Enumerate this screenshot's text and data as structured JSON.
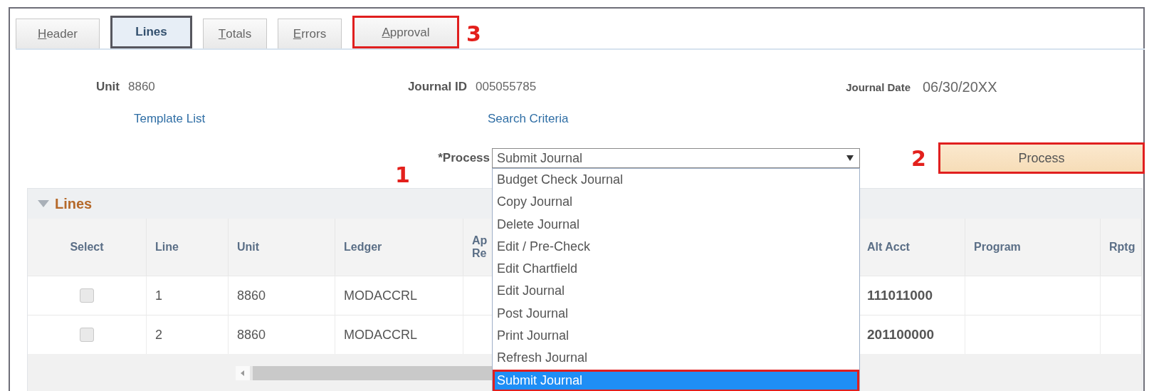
{
  "tabs": [
    {
      "label": "Header",
      "mnemonic": true,
      "selected": false,
      "highlighted": false
    },
    {
      "label": "Lines",
      "mnemonic": false,
      "selected": true,
      "highlighted": false
    },
    {
      "label": "Totals",
      "mnemonic": true,
      "selected": false,
      "highlighted": false
    },
    {
      "label": "Errors",
      "mnemonic": true,
      "selected": false,
      "highlighted": false
    },
    {
      "label": "Approval",
      "mnemonic": true,
      "selected": false,
      "highlighted": true,
      "callout": "3"
    }
  ],
  "header": {
    "unit": {
      "label": "Unit",
      "value": "8860"
    },
    "journal_id": {
      "label": "Journal ID",
      "value": "005055785"
    },
    "journal_date": {
      "label": "Journal Date",
      "value": "06/30/20XX"
    },
    "links": [
      "Template List",
      "Search Criteria"
    ],
    "process_field": {
      "label": "*Process",
      "value": "Submit Journal",
      "callout": "1",
      "expanded": true,
      "options": [
        {
          "label": "Budget Check Journal",
          "selected": false,
          "highlighted": false
        },
        {
          "label": "Copy Journal",
          "selected": false,
          "highlighted": false
        },
        {
          "label": "Delete Journal",
          "selected": false,
          "highlighted": false
        },
        {
          "label": "Edit / Pre-Check",
          "selected": false,
          "highlighted": false
        },
        {
          "label": "Edit Chartfield",
          "selected": false,
          "highlighted": false
        },
        {
          "label": "Edit Journal",
          "selected": false,
          "highlighted": false
        },
        {
          "label": "Post Journal",
          "selected": false,
          "highlighted": false
        },
        {
          "label": "Print Journal",
          "selected": false,
          "highlighted": false
        },
        {
          "label": "Refresh Journal",
          "selected": false,
          "highlighted": false
        },
        {
          "label": "Submit Journal",
          "selected": true,
          "highlighted": true
        }
      ]
    },
    "process_button": {
      "label": "Process",
      "highlighted": true,
      "callout": "2"
    }
  },
  "lines": {
    "title": "Lines",
    "expanded": true,
    "columns": [
      "Select",
      "Line",
      "Unit",
      "Ledger",
      "Ap Re",
      "Alt Acct",
      "Program",
      "Rptg"
    ],
    "rows": [
      {
        "selected": false,
        "cells": [
          "",
          "1",
          "8860",
          "MODACCRL",
          "",
          "111011000",
          "",
          ""
        ]
      },
      {
        "selected": false,
        "cells": [
          "",
          "2",
          "8860",
          "MODACCRL",
          "",
          "201100000",
          "",
          ""
        ]
      }
    ]
  }
}
